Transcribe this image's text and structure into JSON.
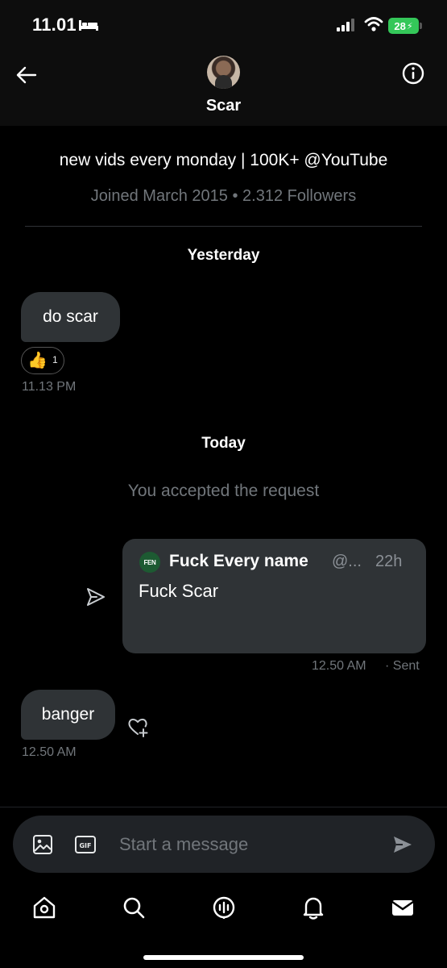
{
  "status_bar": {
    "time": "11.01",
    "battery": "28"
  },
  "header": {
    "name": "Scar"
  },
  "profile": {
    "bio": "new vids every monday | 100K+ @YouTube",
    "joined": "Joined March 2015 • 2.312 Followers"
  },
  "conversation": {
    "day_yesterday": "Yesterday",
    "msg1": {
      "text": "do scar",
      "reaction_emoji": "👍",
      "reaction_count": "1",
      "time": "11.13 PM"
    },
    "day_today": "Today",
    "system_message": "You accepted the request",
    "shared_post": {
      "logo_text": "FEN",
      "author": "Fuck Every name",
      "handle": "@...",
      "age": "22h",
      "text": "Fuck Scar",
      "time": "12.50 AM",
      "status": "· Sent"
    },
    "msg2": {
      "text": "banger",
      "time": "12.50 AM"
    }
  },
  "composer": {
    "placeholder": "Start a message"
  },
  "icons": {
    "back": "back-arrow-icon",
    "info": "info-icon",
    "share": "send-outline-icon",
    "add_reaction": "heart-plus-icon",
    "image": "image-icon",
    "gif": "gif-icon",
    "send": "send-icon",
    "nav": [
      "home-icon",
      "search-icon",
      "spaces-icon",
      "notifications-icon",
      "messages-icon"
    ]
  },
  "colors": {
    "bubble": "#2f3336",
    "muted": "#71767b",
    "battery": "#34c759",
    "background": "#000000"
  }
}
